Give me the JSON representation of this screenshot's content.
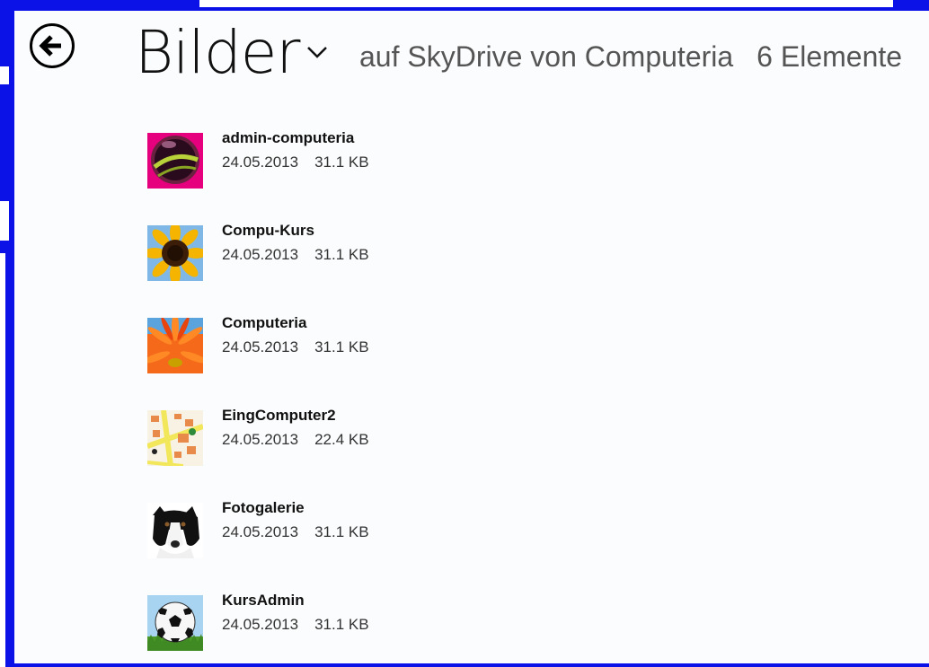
{
  "header": {
    "title": "Bilder",
    "location": "auf SkyDrive von Computeria",
    "item_count": "6 Elemente"
  },
  "files": [
    {
      "name": "admin-computeria",
      "date": "24.05.2013",
      "size": "31.1 KB",
      "thumbnail": "striped-ball"
    },
    {
      "name": "Compu-Kurs",
      "date": "24.05.2013",
      "size": "31.1 KB",
      "thumbnail": "sunflower"
    },
    {
      "name": "Computeria",
      "date": "24.05.2013",
      "size": "31.1 KB",
      "thumbnail": "orange-gerbera"
    },
    {
      "name": "EingComputer2",
      "date": "24.05.2013",
      "size": "22.4 KB",
      "thumbnail": "street-map"
    },
    {
      "name": "Fotogalerie",
      "date": "24.05.2013",
      "size": "31.1 KB",
      "thumbnail": "border-collie"
    },
    {
      "name": "KursAdmin",
      "date": "24.05.2013",
      "size": "31.1 KB",
      "thumbnail": "soccer-ball"
    }
  ],
  "colors": {
    "frame": "#0a12e8",
    "background": "#fbfcfd",
    "title": "#111111",
    "subtitle": "#555555"
  }
}
